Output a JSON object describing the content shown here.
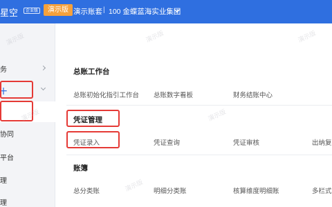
{
  "header": {
    "brand": "星空",
    "edition_tag": "企业版",
    "demo_badge": "演示版",
    "account": "演示账套",
    "separator": "|",
    "company": "100 金蝶蓝海实业集团"
  },
  "sidebar": {
    "items": [
      {
        "label": "务"
      },
      {
        "label": "十"
      },
      {
        "label": "协同"
      },
      {
        "label": "平台"
      },
      {
        "label": "理"
      },
      {
        "label": "理"
      }
    ]
  },
  "sections": [
    {
      "title": "总账工作台",
      "links": [
        "总账初始化指引工作台",
        "总账数字看板",
        "财务结账中心"
      ]
    },
    {
      "title": "凭证管理",
      "links": [
        "凭证录入",
        "凭证查询",
        "凭证审核",
        "出纳复核"
      ]
    },
    {
      "title": "账簿",
      "links": [
        "总分类账",
        "明细分类账",
        "核算维度明细账",
        "多栏式明细"
      ]
    }
  ],
  "watermark": "演示版",
  "colors": {
    "header_bg": "#2f6fe0",
    "badge": "#f6a13b",
    "highlight": "#e53935"
  }
}
